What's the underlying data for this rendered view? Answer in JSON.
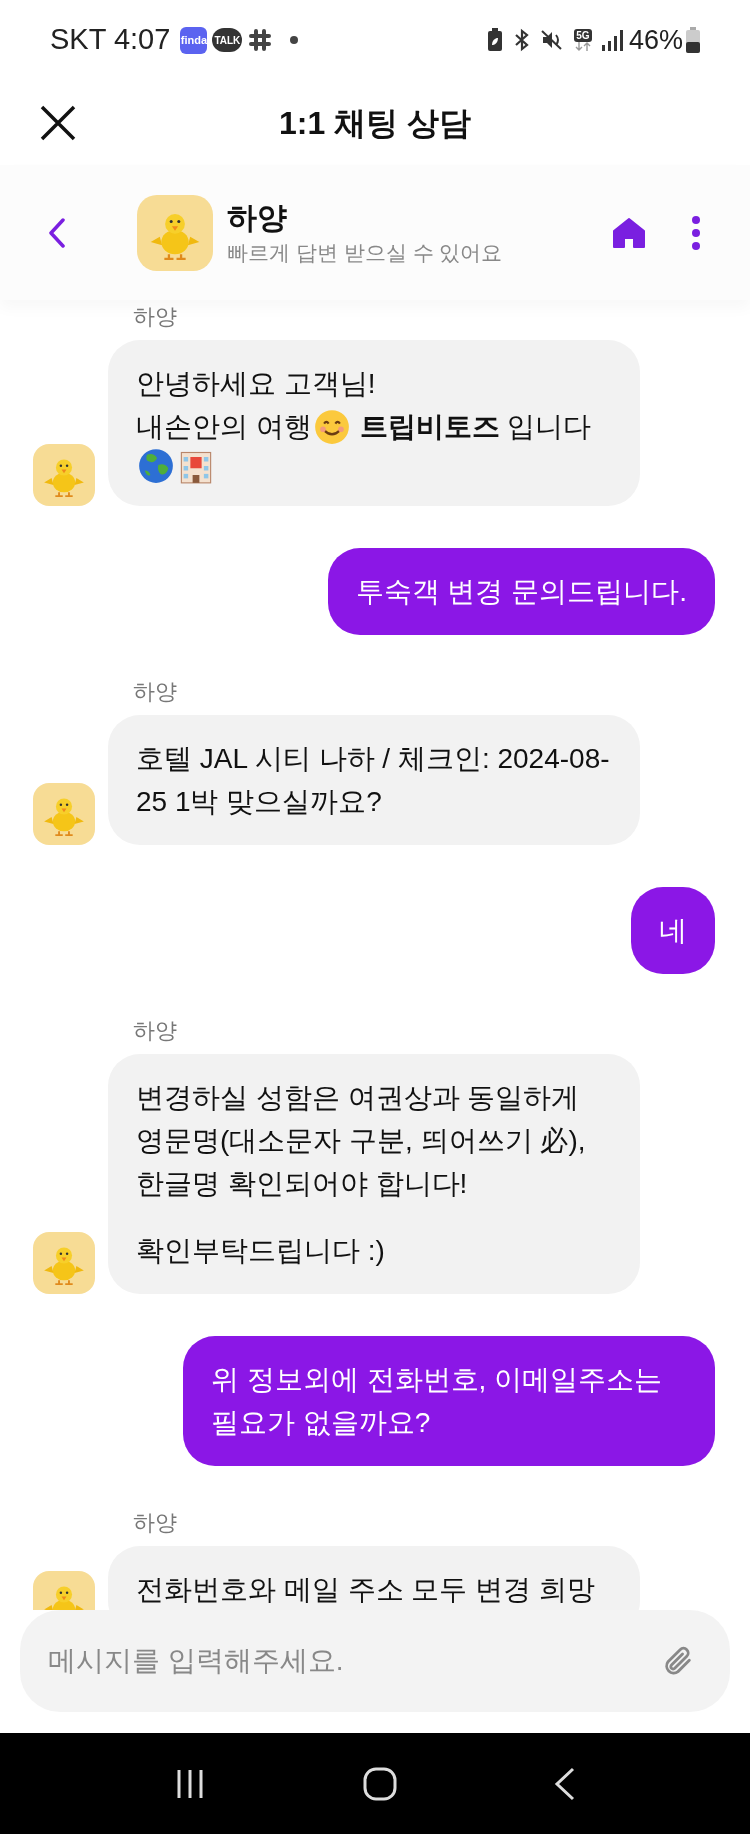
{
  "status_bar": {
    "carrier_time": "SKT 4:07",
    "app_badges": [
      "finda",
      "TALK"
    ],
    "network": "5G",
    "battery": "46%"
  },
  "title_bar": {
    "title": "1:1 채팅 상담"
  },
  "chat_header": {
    "name": "하양",
    "subtitle": "빠르게 답변 받으실 수 있어요"
  },
  "messages": [
    {
      "kind": "received",
      "sender": "하양",
      "paragraphs": [
        [
          [
            {
              "kind": "text",
              "text": "안녕하세요 고객님!"
            }
          ],
          [
            {
              "kind": "text",
              "text": "내손안의 여행"
            },
            {
              "kind": "smile_emoji"
            },
            {
              "kind": "text",
              "text": " **트립비토즈** 입니다"
            }
          ],
          [
            {
              "kind": "globe_emoji"
            },
            {
              "kind": "hotel_emoji"
            }
          ]
        ]
      ]
    },
    {
      "kind": "sent",
      "paragraphs": [
        [
          [
            {
              "kind": "text",
              "text": "투숙객 변경 문의드립니다."
            }
          ]
        ]
      ]
    },
    {
      "kind": "received",
      "sender": "하양",
      "paragraphs": [
        [
          [
            {
              "kind": "text",
              "text": "호텔 JAL 시티 나하 / 체크인: 2024-08-25 1박 맞으실까요?"
            }
          ]
        ]
      ]
    },
    {
      "kind": "sent",
      "paragraphs": [
        [
          [
            {
              "kind": "text",
              "text": "네"
            }
          ]
        ]
      ]
    },
    {
      "kind": "received",
      "sender": "하양",
      "paragraphs": [
        [
          [
            {
              "kind": "text",
              "text": "변경하실 성함은 여권상과 동일하게 영문명(대소문자 구분, 띄어쓰기 必), 한글명 확인되어야 합니다!"
            }
          ]
        ],
        [
          [
            {
              "kind": "text",
              "text": "확인부탁드립니다 :)"
            }
          ]
        ]
      ]
    },
    {
      "kind": "sent",
      "paragraphs": [
        [
          [
            {
              "kind": "text",
              "text": "위 정보외에 전화번호, 이메일주소는 필요가 없을까요?"
            }
          ]
        ]
      ]
    },
    {
      "kind": "received",
      "sender": "하양",
      "paragraphs": [
        [
          [
            {
              "kind": "text",
              "text": "전화번호와 메일 주소 모두 변경 희망"
            }
          ]
        ]
      ]
    }
  ],
  "composer": {
    "placeholder": "메시지를 입력해주세요."
  }
}
